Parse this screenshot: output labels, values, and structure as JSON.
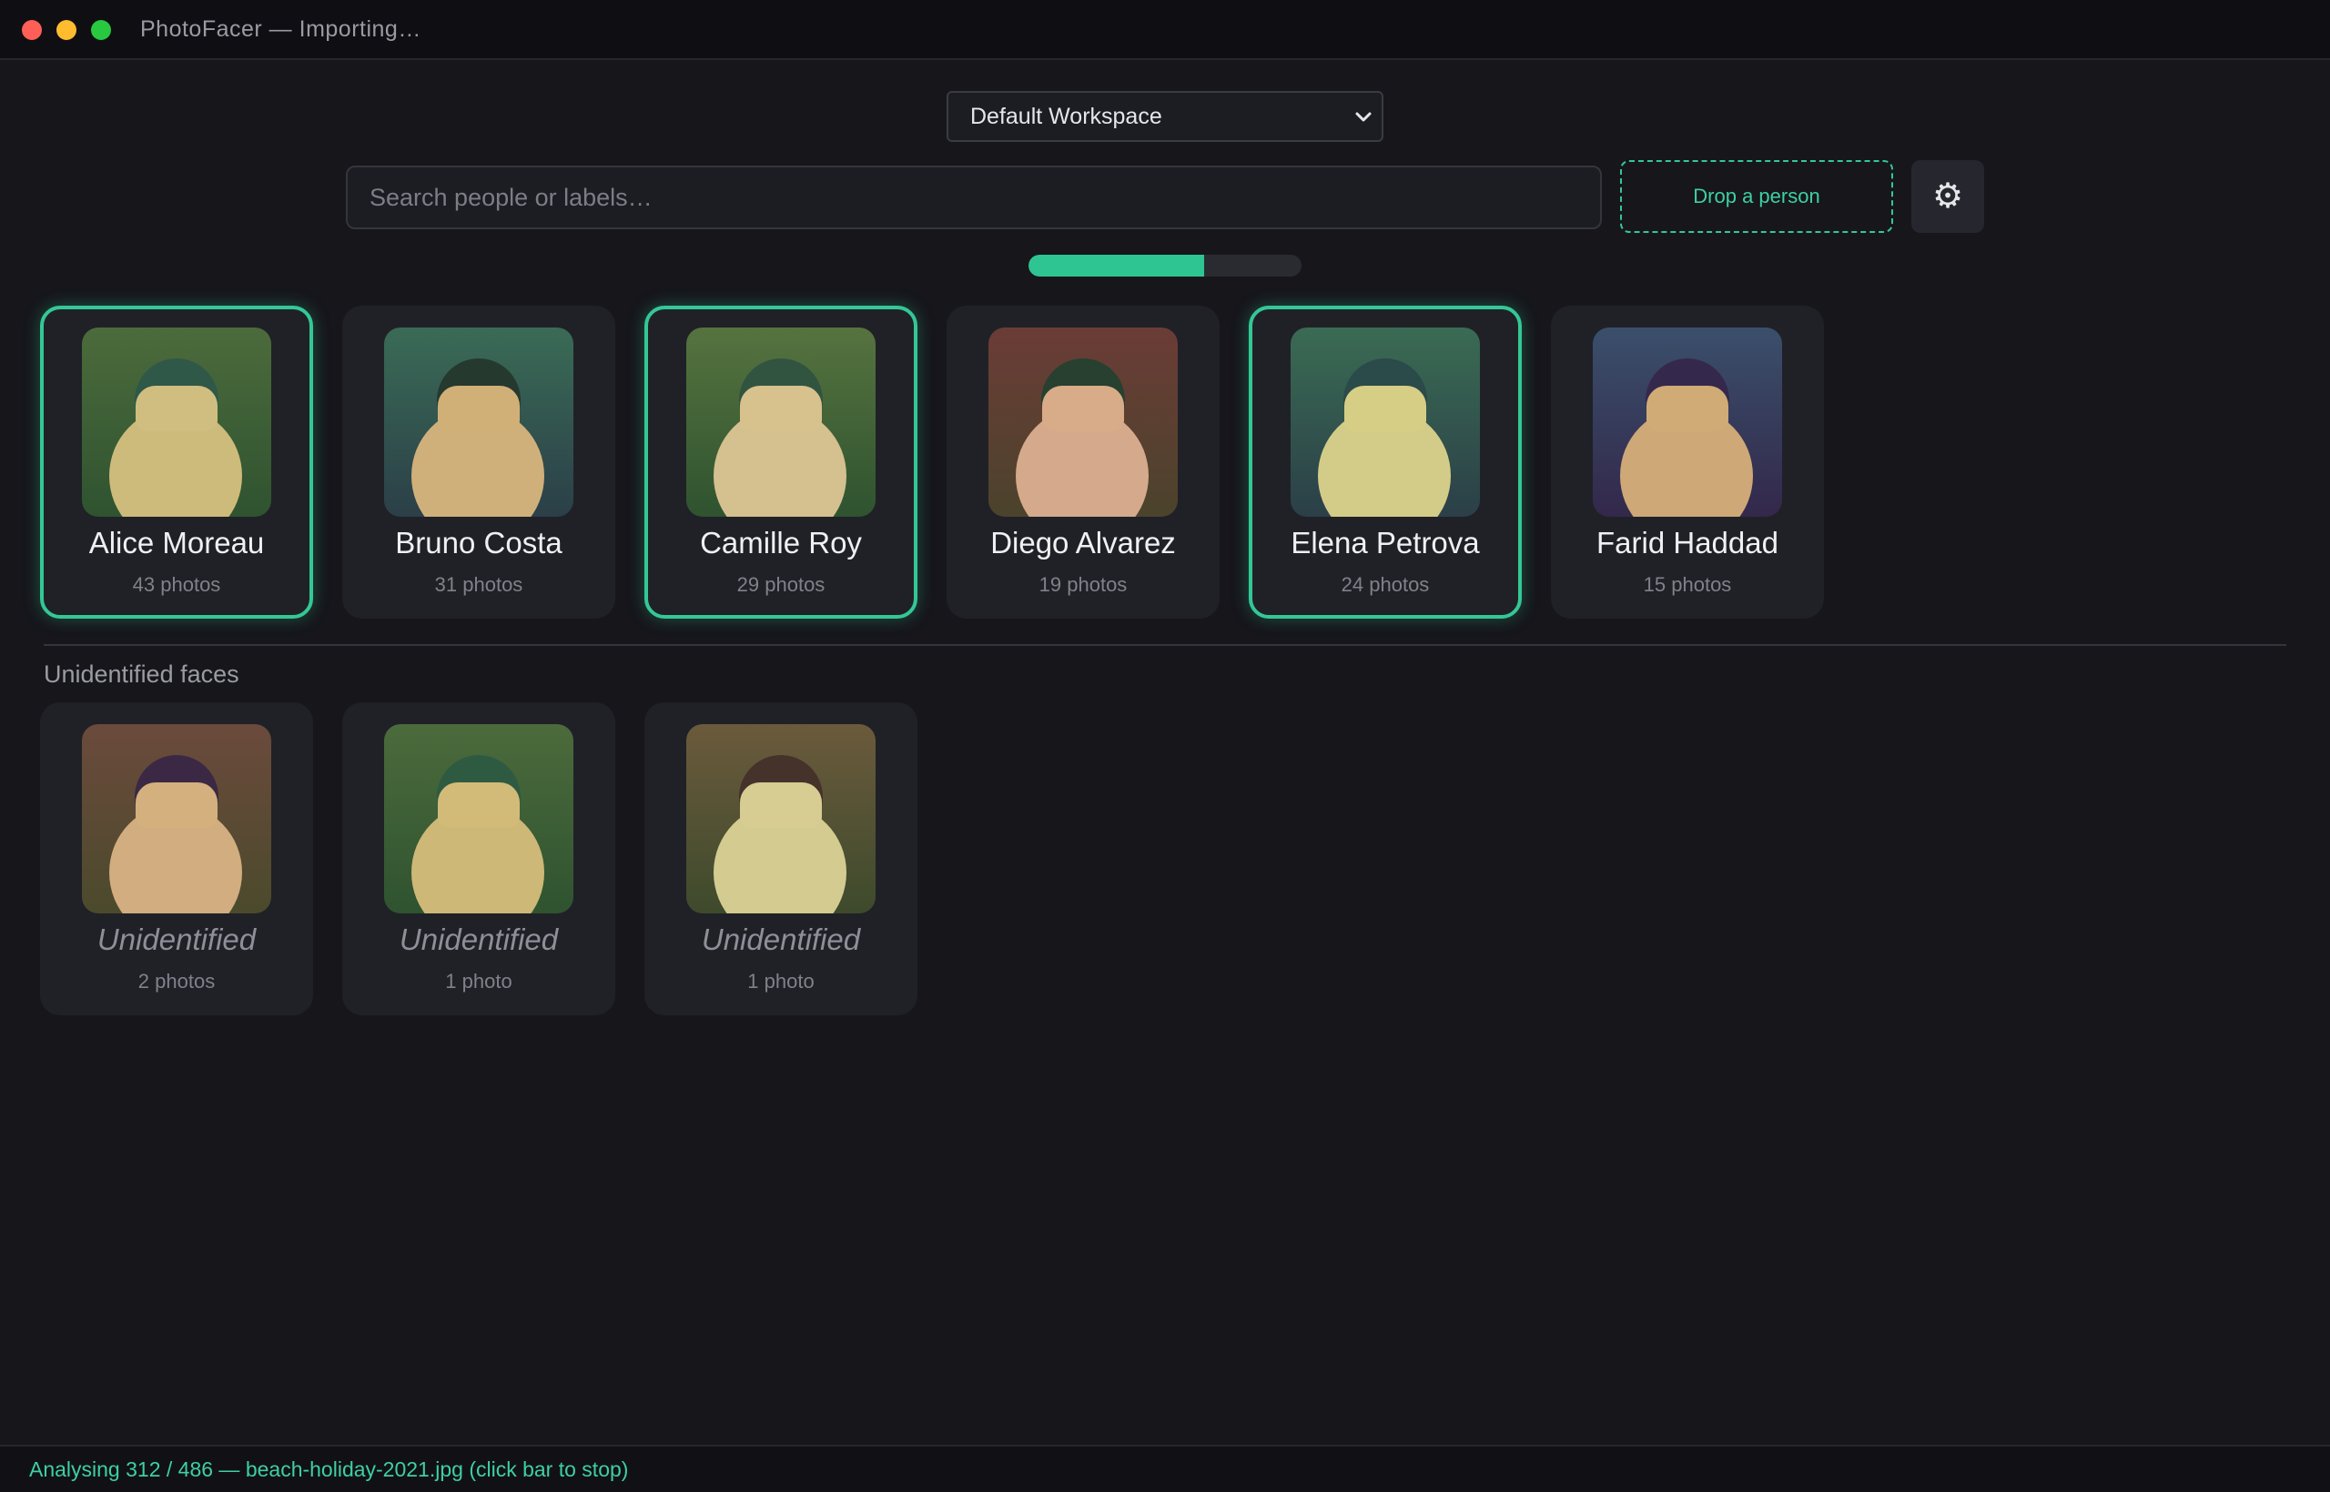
{
  "window": {
    "title": "PhotoFacer — Importing…"
  },
  "toolbar": {
    "workspace_selected": "Default Workspace",
    "search_placeholder": "Search people or labels…",
    "search_value": "",
    "dropzone_label": "Drop a person",
    "settings_icon": "⚙"
  },
  "progress": {
    "fraction": 0.642
  },
  "people": [
    {
      "name": "Alice Moreau",
      "count": "43 photos",
      "selected": true,
      "bg": [
        "#4c6b3c",
        "#2f5330"
      ],
      "hair": "#2f5848",
      "skin": "#d0be80",
      "body": "#cdbb7b"
    },
    {
      "name": "Bruno Costa",
      "count": "31 photos",
      "selected": false,
      "bg": [
        "#3a6b56",
        "#2b3f48"
      ],
      "hair": "#25392f",
      "skin": "#d1b078",
      "body": "#d0b07a"
    },
    {
      "name": "Camille Roy",
      "count": "29 photos",
      "selected": true,
      "bg": [
        "#56733f",
        "#2f5330"
      ],
      "hair": "#315440",
      "skin": "#d7c18d",
      "body": "#d5c08f"
    },
    {
      "name": "Diego Alvarez",
      "count": "19 photos",
      "selected": false,
      "bg": [
        "#6b3c36",
        "#4b432c"
      ],
      "hair": "#27402f",
      "skin": "#d8ac88",
      "body": "#d5a98b"
    },
    {
      "name": "Elena Petrova",
      "count": "24 photos",
      "selected": true,
      "bg": [
        "#3a6b53",
        "#2b3f48"
      ],
      "hair": "#2b4a4a",
      "skin": "#d6ce85",
      "body": "#d3cc88"
    },
    {
      "name": "Farid Haddad",
      "count": "15 photos",
      "selected": false,
      "bg": [
        "#3a4f6b",
        "#33284b"
      ],
      "hair": "#35284d",
      "skin": "#d0ab75",
      "body": "#cfa878"
    }
  ],
  "unidentified": {
    "section_title": "Unidentified faces",
    "faces": [
      {
        "name": "Unidentified",
        "count": "2 photos",
        "bg": [
          "#6b4a3c",
          "#4b4a2c"
        ],
        "hair": "#3b2844",
        "skin": "#d3b07d",
        "body": "#d1ad7f"
      },
      {
        "name": "Unidentified",
        "count": "1 photo",
        "bg": [
          "#4c6b3c",
          "#2f5330"
        ],
        "hair": "#2f5a42",
        "skin": "#d2bb78",
        "body": "#cdb877"
      },
      {
        "name": "Unidentified",
        "count": "1 photo",
        "bg": [
          "#6b5a3c",
          "#3e4a2c"
        ],
        "hair": "#45322b",
        "skin": "#d7cc92",
        "body": "#d4cb90"
      }
    ]
  },
  "status": {
    "text": "Analysing 312 / 486 — beach-holiday-2021.jpg (click bar to stop)"
  }
}
